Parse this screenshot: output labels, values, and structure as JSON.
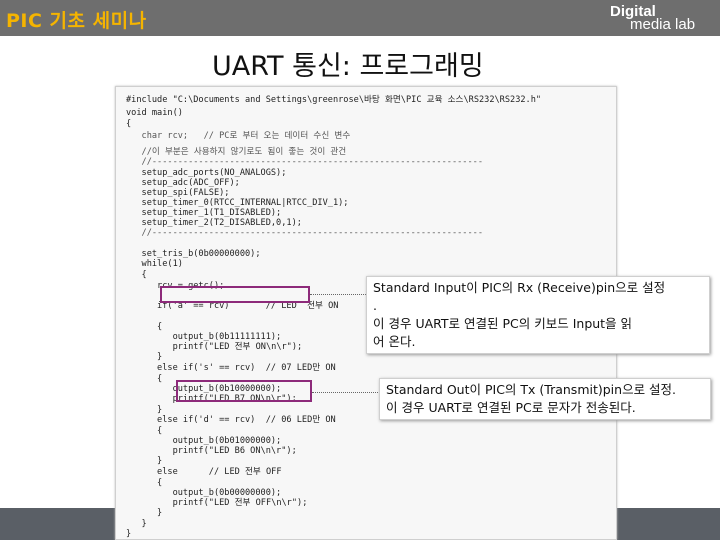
{
  "header": {
    "title": "PIC 기초 세미나",
    "logo_line1": "Digital",
    "logo_line2": "media lab"
  },
  "slide": {
    "title": "UART 통신: 프로그래밍"
  },
  "code": {
    "lines": [
      "#include \"C:\\Documents and Settings\\greenrose\\바탕 화면\\PIC 교육 소스\\RS232\\RS232.h\"",
      "void main()",
      "{",
      "   char rcv;   // PC로 부터 오는 데이터 수신 변수",
      "   //이 부분은 사용하지 않기로도 됨이 좋는 것이 관건",
      "   //----------------------------------------------------------------",
      "   setup_adc_ports(NO_ANALOGS);",
      "   setup_adc(ADC_OFF);",
      "   setup_spi(FALSE);",
      "   setup_timer_0(RTCC_INTERNAL|RTCC_DIV_1);",
      "   setup_timer_1(T1_DISABLED);",
      "   setup_timer_2(T2_DISABLED,0,1);",
      "   //----------------------------------------------------------------",
      "",
      "   set_tris_b(0b00000000);",
      "   while(1)",
      "   {",
      "      rcv = getc();",
      "",
      "      if('a' == rcv)       // LED  전부 ON",
      "      {",
      "         output_b(0b11111111);",
      "         printf(\"LED 전부 ON\\n\\r\");",
      "      }",
      "      else if('s' == rcv)  // 07 LED만 ON",
      "      {",
      "         output_b(0b10000000);",
      "         printf(\"LED B7 ON\\n\\r\");",
      "      }",
      "      else if('d' == rcv)  // 06 LED만 ON",
      "      {",
      "         output_b(0b01000000);",
      "         printf(\"LED B6 ON\\n\\r\");",
      "      }",
      "      else      // LED 전부 OFF",
      "      {",
      "         output_b(0b00000000);",
      "         printf(\"LED 전부 OFF\\n\\r\");",
      "      }",
      "   }",
      "}"
    ]
  },
  "callouts": {
    "input_lines": [
      "Standard Input이 PIC의 Rx (Receive)pin으로 설정",
      ".",
      "이 경우 UART로 연결된 PC의 키보드 Input을 읽",
      "어 온다."
    ],
    "output_lines": [
      "Standard Out이 PIC의 Tx (Transmit)pin으로 설정.",
      "이 경우 UART로 연결된 PC로 문자가 전송된다."
    ]
  }
}
